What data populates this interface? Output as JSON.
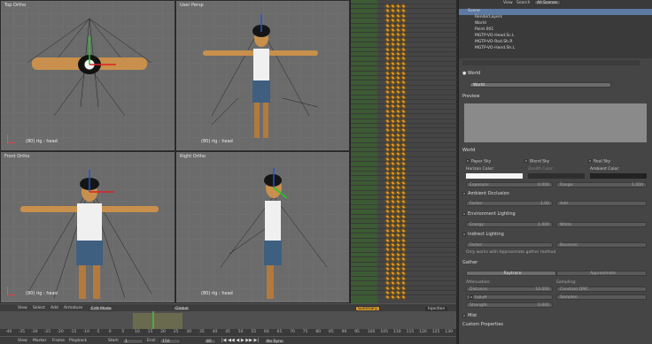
{
  "viewports": [
    {
      "title": "Top Ortho",
      "label": "(80) rig : head"
    },
    {
      "title": "User Persp",
      "label": "(80) rig : head"
    },
    {
      "title": "Front Ortho",
      "label": "(80) rig : head"
    },
    {
      "title": "Right Ortho",
      "label": "(80) rig : head"
    }
  ],
  "view_header": {
    "menus": [
      "View",
      "Select",
      "Add",
      "Armature"
    ],
    "mode": "Edit Mode",
    "pivot": "Global"
  },
  "dope_header": {
    "mode": "Summary",
    "filter": "Injection"
  },
  "timeline": {
    "ruler": [
      "-40",
      "-35",
      "-30",
      "-25",
      "-20",
      "-15",
      "-10",
      "-5",
      "0",
      "5",
      "10",
      "15",
      "20",
      "25",
      "30",
      "35",
      "40",
      "45",
      "50",
      "55",
      "60",
      "65",
      "70",
      "75",
      "80",
      "85",
      "90",
      "95",
      "100",
      "105",
      "110",
      "115",
      "120",
      "125",
      "130"
    ],
    "menus": [
      "View",
      "Marker",
      "Frame",
      "Playback"
    ],
    "start_label": "Start:",
    "start": "1",
    "end_label": "End:",
    "end": "150",
    "current": "80",
    "sync": "No Sync"
  },
  "outliner": {
    "menus": [
      "View",
      "Search",
      "All Scenes"
    ],
    "rows": [
      "Scene",
      "RenderLayers",
      "World",
      "Point.001",
      "MGTP-VO-Head.Sc.L",
      "MGTP-VO-Rod.Sh.R",
      "MGTP-VO-Hand.Sh.L"
    ]
  },
  "props": {
    "world_name": "World",
    "world_field": "World",
    "preview": "Preview",
    "world_section": "World",
    "paper_sky": "Paper Sky",
    "blend_sky": "Blend Sky",
    "real_sky": "Real Sky",
    "horizon_color": "Horizon Color:",
    "zenith_color": "Zenith Color:",
    "ambient_color": "Ambient Color:",
    "exposure": "Exposure:",
    "exposure_val": "0.000",
    "range": "Range:",
    "range_val": "1.000",
    "ambient_occlusion": "Ambient Occlusion",
    "factor": "Factor:",
    "factor_val": "1.00",
    "add": "Add",
    "environment_lighting": "Environment Lighting",
    "energy": "Energy:",
    "energy_val": "1.000",
    "white": "White",
    "indirect_lighting": "Indirect Lighting",
    "bounces": "Bounces:",
    "indirect_note": "Only works with Approximate gather method",
    "gather": "Gather",
    "raytrace": "Raytrace",
    "approximate": "Approximate",
    "attenuation": "Attenuation:",
    "sampling": "Sampling:",
    "distance": "Distance:",
    "distance_val": "10.000",
    "constant_qmc": "Constant QMC",
    "falloff": "Falloff",
    "samples": "Samples:",
    "strength": "Strength:",
    "strength_val": "0.000",
    "mist": "Mist",
    "custom_properties": "Custom Properties"
  }
}
